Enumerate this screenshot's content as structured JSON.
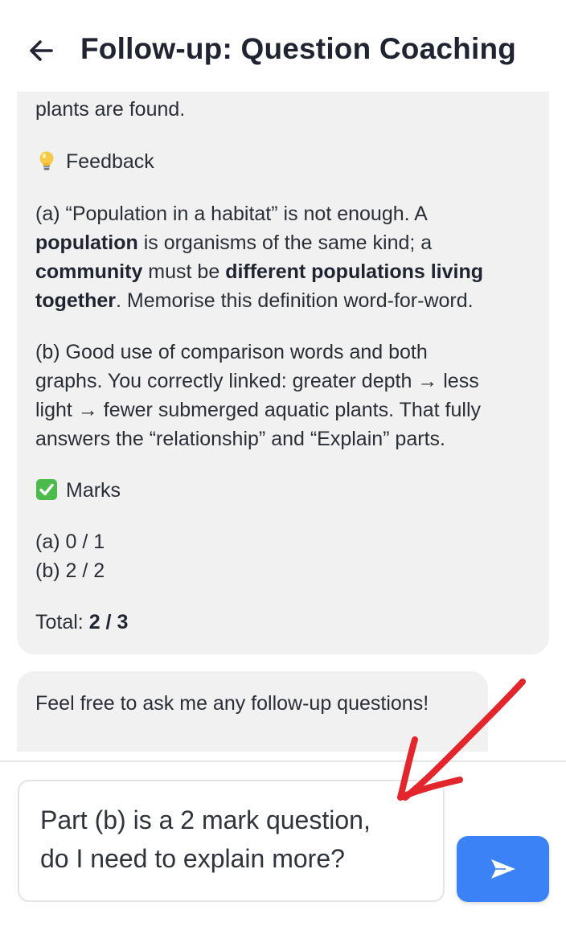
{
  "header": {
    "title": "Follow-up: Question Coaching",
    "back_icon": "arrow-left-icon"
  },
  "message": {
    "top_line": "plants are found.",
    "feedback_heading": "Feedback",
    "feedback_icon": "lightbulb-icon",
    "part_a": {
      "line1": "(a) “Population in a habitat” is not enough. A",
      "line2_bold": "population",
      "line2_rest": " is organisms of the same kind; a",
      "line3_bold1": "community",
      "line3_mid": " must be ",
      "line3_bold2": "different populations living",
      "line4_bold": "together",
      "line4_rest": ". Memorise this definition word-for-word."
    },
    "part_b": [
      "(b) Good use of comparison words and both",
      "graphs. You correctly linked: greater depth → less",
      "light → fewer submerged aquatic plants. That fully",
      "answers the “relationship” and “Explain” parts."
    ],
    "marks_heading": "Marks",
    "marks_icon": "check-box-icon",
    "marks_a": "(a) 0 / 1",
    "marks_b": "(b) 2 / 2",
    "total_label": "Total: ",
    "total_value": "2 / 3"
  },
  "followup_prompt": "Feel free to ask me any follow-up questions!",
  "composer": {
    "value_line1": "Part (b) is a 2 mark question,",
    "value_line2": "do I need to explain more?",
    "send_icon": "send-icon"
  },
  "colors": {
    "accent": "#3b82f6",
    "bubble": "#f1f1f1",
    "annotation": "#e3262b"
  }
}
